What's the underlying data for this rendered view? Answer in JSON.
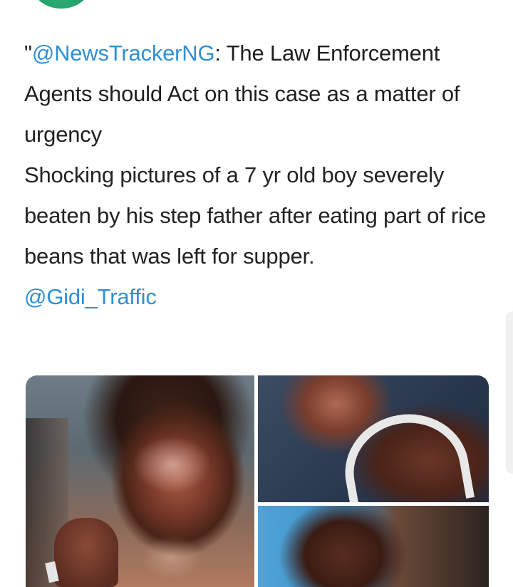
{
  "tweet": {
    "paragraph_1": {
      "quote_open": "\"",
      "mention": "@NewsTrackerNG",
      "text": ": The Law Enforcement Agents should Act on this case as a matter of urgency"
    },
    "paragraph_2": {
      "text": "Shocking pictures of a 7 yr old boy severely beaten by his step father after eating part of rice beans that was left for supper."
    },
    "paragraph_3": {
      "mention": "@Gidi_Traffic"
    }
  },
  "media": {
    "photo_count": 3,
    "photos": [
      {
        "position": "left"
      },
      {
        "position": "top-right"
      },
      {
        "position": "bottom-right"
      }
    ]
  },
  "colors": {
    "mention": "#2f8fd6",
    "text": "#222222",
    "avatar": "#1f9c66"
  }
}
